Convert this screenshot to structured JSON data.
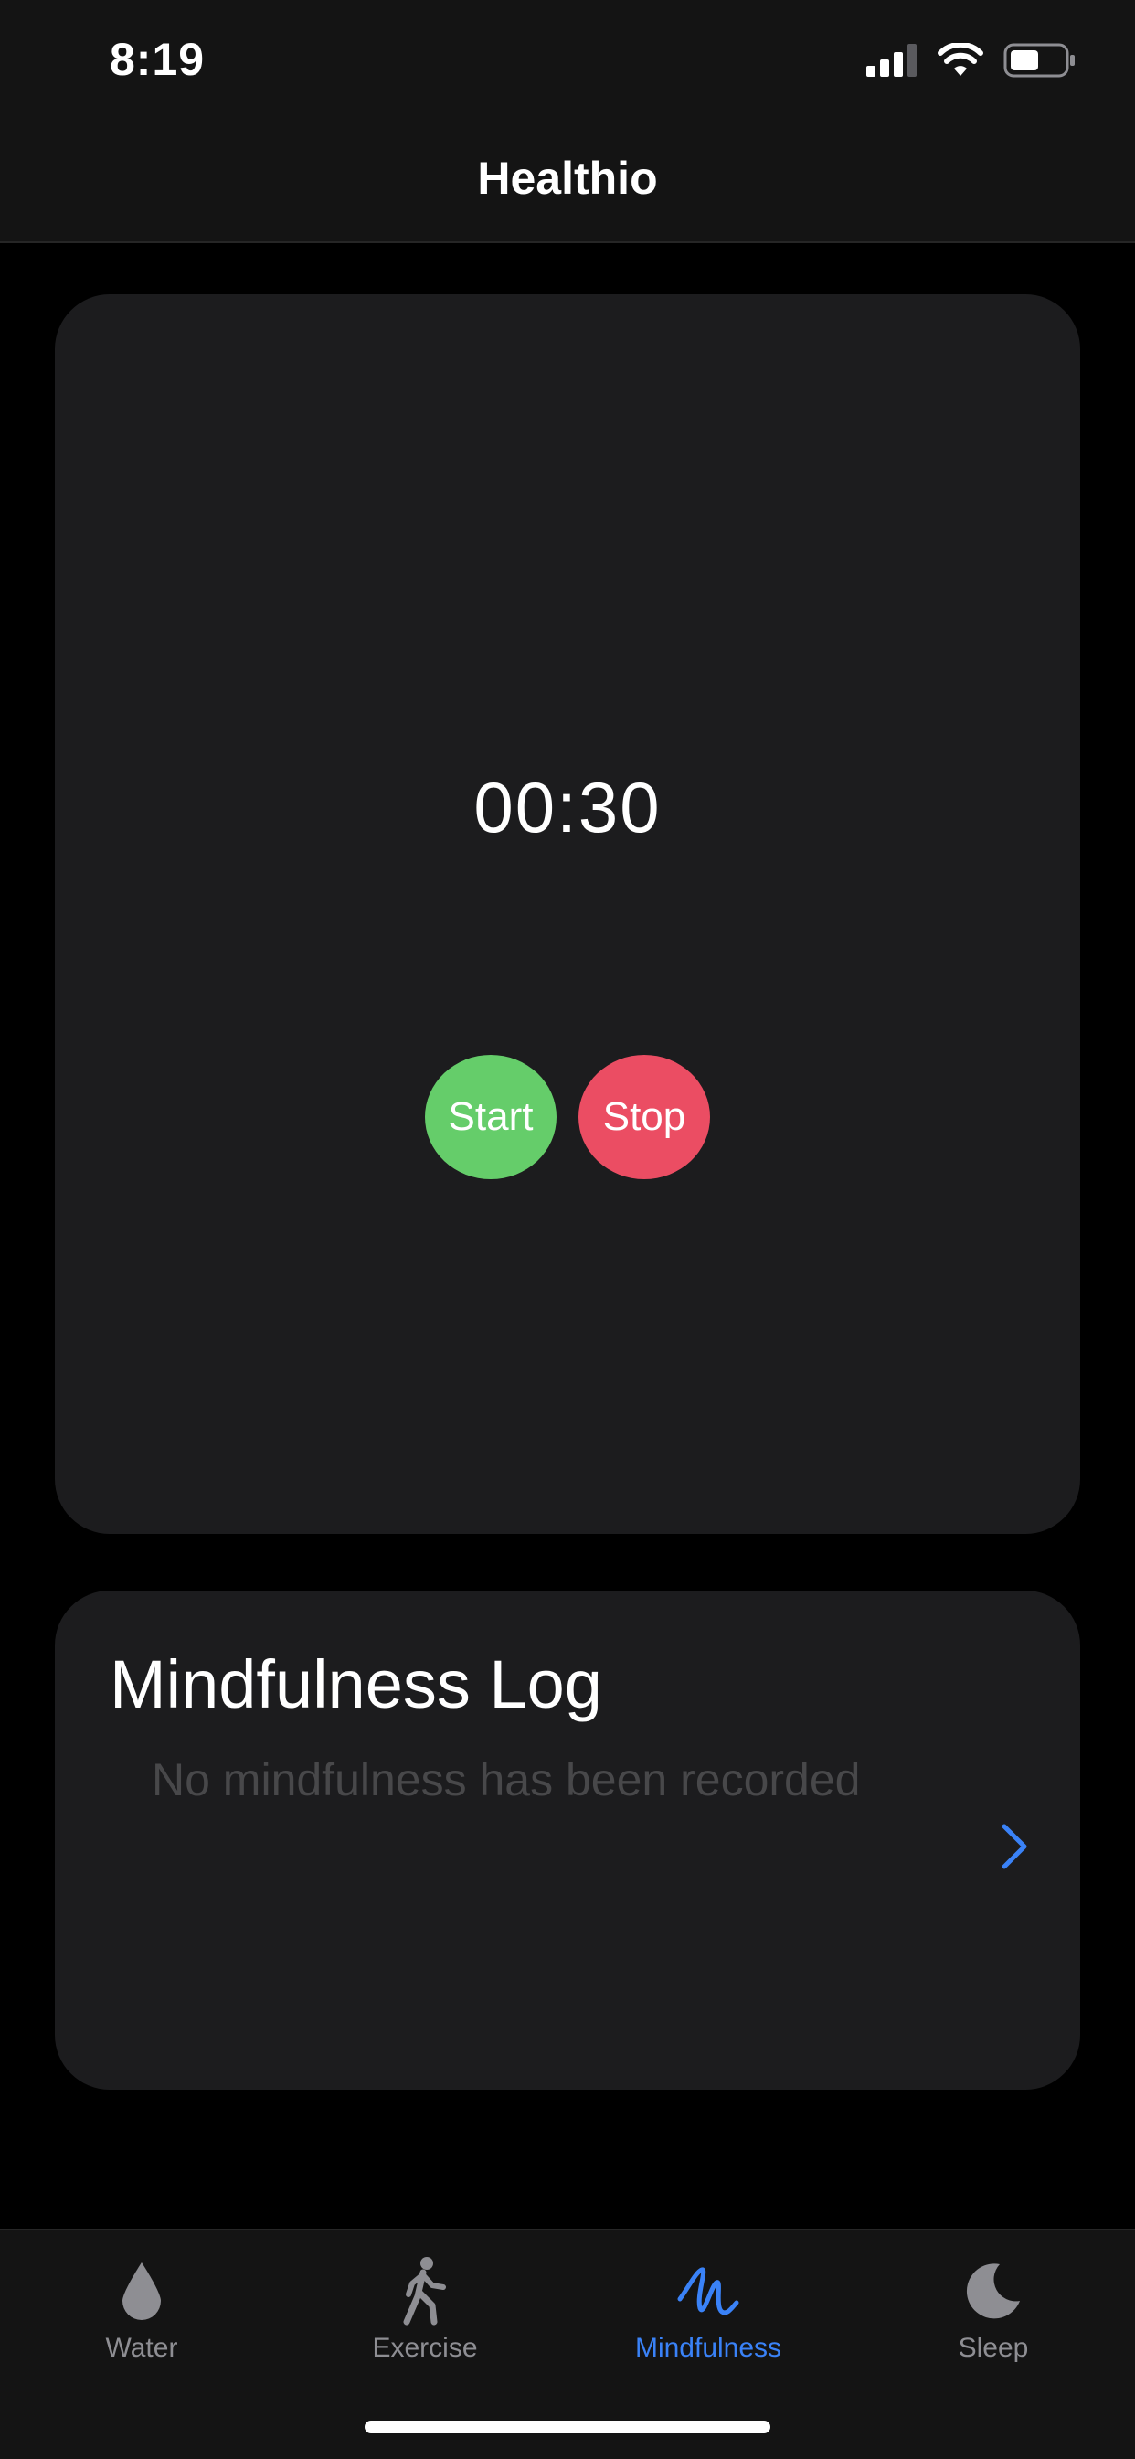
{
  "status_bar": {
    "time": "8:19"
  },
  "nav": {
    "title": "Healthio"
  },
  "timer": {
    "display": "00:30",
    "start_label": "Start",
    "stop_label": "Stop",
    "start_color": "#65cd6a",
    "stop_color": "#eb4d63"
  },
  "log": {
    "title": "Mindfulness Log",
    "empty_text": "No mindfulness has been recorded",
    "chevron_icon": "chevron-right-icon"
  },
  "tabs": [
    {
      "label": "Water",
      "icon": "water-drop-icon",
      "active": false
    },
    {
      "label": "Exercise",
      "icon": "walking-figure-icon",
      "active": false
    },
    {
      "label": "Mindfulness",
      "icon": "scribble-icon",
      "active": true
    },
    {
      "label": "Sleep",
      "icon": "moon-icon",
      "active": false
    }
  ],
  "colors": {
    "accent": "#3a82f7",
    "background": "#000000",
    "card": "#1c1c1e",
    "inactive_tab": "#8e8e93"
  }
}
